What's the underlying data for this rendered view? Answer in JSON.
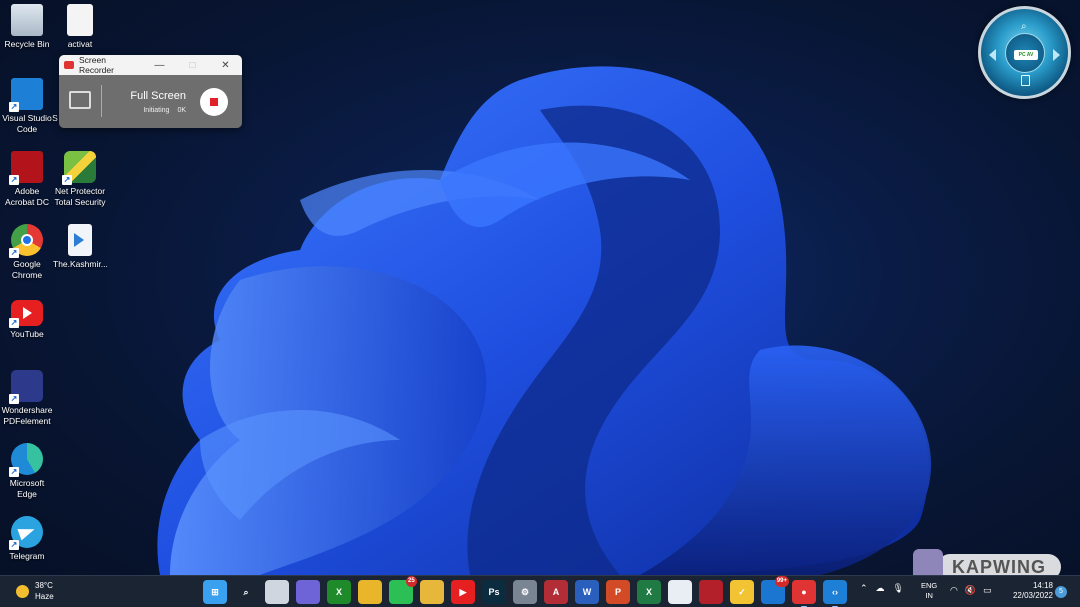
{
  "desktop": {
    "icons": [
      {
        "label": "Recycle Bin"
      },
      {
        "label": "activat"
      },
      {
        "label": "Visual Studio Code"
      },
      {
        "label": "S"
      },
      {
        "label": "Adobe Acrobat DC"
      },
      {
        "label": "Net Protector Total Security"
      },
      {
        "label": "Google Chrome"
      },
      {
        "label": "The.Kashmir..."
      },
      {
        "label": "YouTube"
      },
      {
        "label": "Wondershare PDFelement"
      },
      {
        "label": "Microsoft Edge"
      },
      {
        "label": "Telegram"
      }
    ]
  },
  "recorder": {
    "title": "Screen Recorder",
    "minimize": "—",
    "maximize": "□",
    "close": "✕",
    "mode": "Full Screen",
    "status": "Initiating",
    "size": "0K"
  },
  "gadget": {
    "battery_label": "PC AV"
  },
  "watermark": {
    "text": "KAPWING"
  },
  "taskbar": {
    "weather_temp": "38°C",
    "weather_desc": "Haze",
    "apps": [
      {
        "icon": "windows-start-icon",
        "color": "#3aa0f0",
        "glyph": "⊞"
      },
      {
        "icon": "search-icon",
        "color": "transparent",
        "glyph": "⌕"
      },
      {
        "icon": "task-view-icon",
        "color": "#cfd6df",
        "glyph": ""
      },
      {
        "icon": "teams-chat-icon",
        "color": "#6f63d8",
        "glyph": ""
      },
      {
        "icon": "xbox-icon",
        "color": "#1e8a2a",
        "glyph": "X"
      },
      {
        "icon": "chrome-icon",
        "color": "#e8b52b",
        "glyph": ""
      },
      {
        "icon": "whatsapp-icon",
        "color": "#2bbf55",
        "glyph": "",
        "badge": "25"
      },
      {
        "icon": "file-explorer-icon",
        "color": "#e7b73b",
        "glyph": ""
      },
      {
        "icon": "youtube-icon",
        "color": "#e62020",
        "glyph": "▶"
      },
      {
        "icon": "photoshop-icon",
        "color": "#0b2b3f",
        "glyph": "Ps"
      },
      {
        "icon": "settings-icon",
        "color": "#7a8594",
        "glyph": "⚙"
      },
      {
        "icon": "access-icon",
        "color": "#b32d36",
        "glyph": "A"
      },
      {
        "icon": "word-icon",
        "color": "#2b5fbe",
        "glyph": "W"
      },
      {
        "icon": "powerpoint-icon",
        "color": "#d24b26",
        "glyph": "P"
      },
      {
        "icon": "excel-icon",
        "color": "#1f7a43",
        "glyph": "X"
      },
      {
        "icon": "store-icon",
        "color": "#e9eef5",
        "glyph": ""
      },
      {
        "icon": "red-app-icon",
        "color": "#b3202a",
        "glyph": ""
      },
      {
        "icon": "norton-icon",
        "color": "#f2c333",
        "glyph": "✓"
      },
      {
        "icon": "mail-icon",
        "color": "#1b76d2",
        "glyph": "",
        "badge": "99+"
      },
      {
        "icon": "screen-recorder-icon",
        "color": "#e03434",
        "glyph": "●",
        "active": true
      },
      {
        "icon": "vscode-icon",
        "color": "#1e7fd6",
        "glyph": "‹›",
        "active": true
      }
    ],
    "lang_line1": "ENG",
    "lang_line2": "IN",
    "time": "14:18",
    "date": "22/03/2022",
    "notification_count": "5"
  }
}
